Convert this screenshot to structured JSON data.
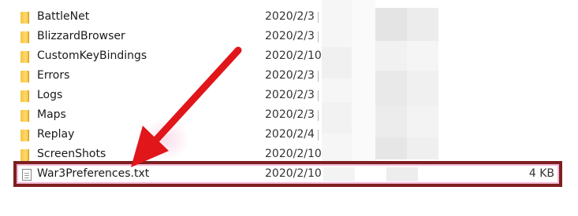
{
  "files": [
    {
      "name": "BattleNet",
      "date": "2020/2/3",
      "type": "folder",
      "icon": "folder-icon"
    },
    {
      "name": "BlizzardBrowser",
      "date": "2020/2/3",
      "type": "folder",
      "icon": "folder-icon"
    },
    {
      "name": "CustomKeyBindings",
      "date": "2020/2/10",
      "type": "folder",
      "icon": "folder-icon"
    },
    {
      "name": "Errors",
      "date": "2020/2/3",
      "type": "folder",
      "icon": "folder-icon"
    },
    {
      "name": "Logs",
      "date": "2020/2/3",
      "type": "folder",
      "icon": "folder-icon"
    },
    {
      "name": "Maps",
      "date": "2020/2/3",
      "type": "folder",
      "icon": "folder-icon"
    },
    {
      "name": "Replay",
      "date": "2020/2/4",
      "type": "folder",
      "icon": "folder-icon"
    },
    {
      "name": "ScreenShots",
      "date": "2020/2/10",
      "type": "folder",
      "icon": "folder-icon"
    }
  ],
  "highlighted_file": {
    "name": "War3Preferences.txt",
    "date": "2020/2/10",
    "size": "4 KB",
    "icon": "text-file-icon"
  },
  "colors": {
    "highlight_border": "#7e1f1f",
    "arrow": "#e0161a",
    "folder": "#f4c542"
  }
}
